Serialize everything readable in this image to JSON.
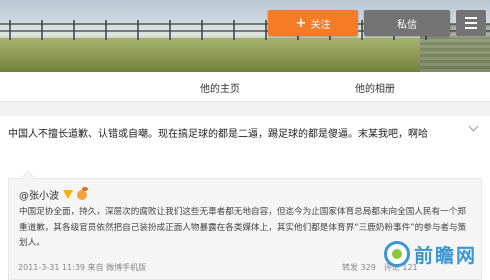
{
  "header": {
    "follow_label": "关注",
    "message_label": "私信"
  },
  "tabs": {
    "home": "他的主页",
    "album": "他的相册"
  },
  "post": {
    "text": "中国人不擅长道歉、认错或自嘲。现在搞足球的都是二逼，踢足球的都是傻逼。末某我吧，啊哈"
  },
  "repost": {
    "author": "@张小波",
    "text": "中国足协全面，持久，深层次的腐败让我们这些无辜者都无地自容，但迄今为止国家体育总局都未向全国人民有一个郑重道歉，其各级官员依然把自己装扮成正面人物暴露在各类媒体上，其实他们都是体育界“三鹿奶粉事件”的参与者与策划人。",
    "meta": "2011-3-31 11:39 来自 微博手机版",
    "repost_count": "转发 329",
    "comment_count": "评论 121"
  },
  "watermark": {
    "text": "前瞻网"
  },
  "colors": {
    "follow": "#f57b27",
    "secondary_button": "#737373",
    "watermark": "#3a97d3"
  }
}
